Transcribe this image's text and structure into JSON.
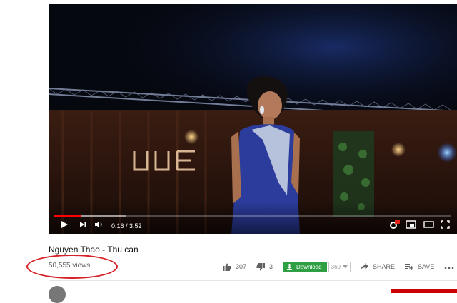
{
  "video": {
    "time_current": "0:16",
    "time_total": "3:52",
    "time_separator": " / ",
    "progress_played": 0.069,
    "progress_loaded": 0.18
  },
  "meta": {
    "title": "Nguyen Thao - Thu can",
    "views": "50,555 views"
  },
  "actions": {
    "likes": "307",
    "dislikes": "3",
    "download_label": "Download",
    "quality": "360",
    "share_label": "SHARE",
    "save_label": "SAVE"
  },
  "colors": {
    "progress": "#ff0000",
    "download": "#2ea043",
    "annotation": "#d61f26"
  }
}
